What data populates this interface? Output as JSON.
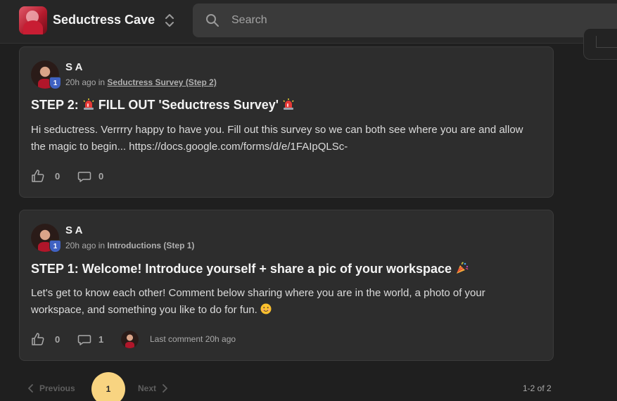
{
  "app": {
    "title": "Seductress Cave"
  },
  "search": {
    "placeholder": "Search"
  },
  "posts": [
    {
      "author": "S A",
      "level": "1",
      "time": "20h ago",
      "in_word": "in",
      "category": "Seductress Survey (Step 2)",
      "title_text": "STEP 2: ",
      "title_main": " FILL OUT 'Seductress Survey' ",
      "body": "Hi seductress. Verrrry happy to have you. Fill out this survey so we can both see where you are and allow the magic to begin... https://docs.google.com/forms/d/e/1FAIpQLSc-",
      "likes": "0",
      "comments": "0"
    },
    {
      "author": "S A",
      "level": "1",
      "time": "20h ago",
      "in_word": "in",
      "category": "Introductions (Step 1)",
      "title_text": "STEP 1: Welcome! Introduce yourself + share a pic of your workspace ",
      "body": "Let's get to know each other! Comment below sharing where you are in the world, a photo of your workspace, and something you like to do for fun. ",
      "likes": "0",
      "comments": "1",
      "last_comment": "Last comment 20h ago"
    }
  ],
  "pagination": {
    "previous": "Previous",
    "current": "1",
    "next": "Next",
    "range": "1-2 of 2"
  },
  "colors": {
    "accent_page": "#f8d481",
    "level_badge": "#4062c2",
    "card_bg": "#2d2d2d",
    "page_bg": "#1f1f1f"
  },
  "icons": [
    "switch-community-icon",
    "search-icon",
    "like-icon",
    "comment-icon",
    "siren-emoji",
    "party-popper-emoji",
    "smile-emoji",
    "chevron-left-icon",
    "chevron-right-icon"
  ]
}
